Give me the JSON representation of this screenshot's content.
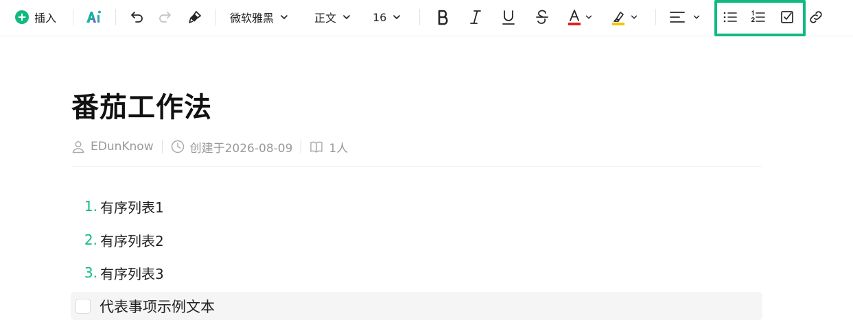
{
  "toolbar": {
    "insert_label": "插入",
    "font_family": "微软雅黑",
    "paragraph_style": "正文",
    "font_size": "16",
    "colors": {
      "accent": "#10b981",
      "text_color_bar": "#e02020",
      "highlight_bar": "#f5c400"
    }
  },
  "document": {
    "title": "番茄工作法",
    "meta": {
      "author": "EDunKnow",
      "created": "创建于2026-08-09",
      "readers": "1人"
    },
    "ordered_list": [
      {
        "num": "1.",
        "text": "有序列表1"
      },
      {
        "num": "2.",
        "text": "有序列表2"
      },
      {
        "num": "3.",
        "text": "有序列表3"
      }
    ],
    "todo": {
      "text": "代表事项示例文本",
      "checked": false
    }
  }
}
